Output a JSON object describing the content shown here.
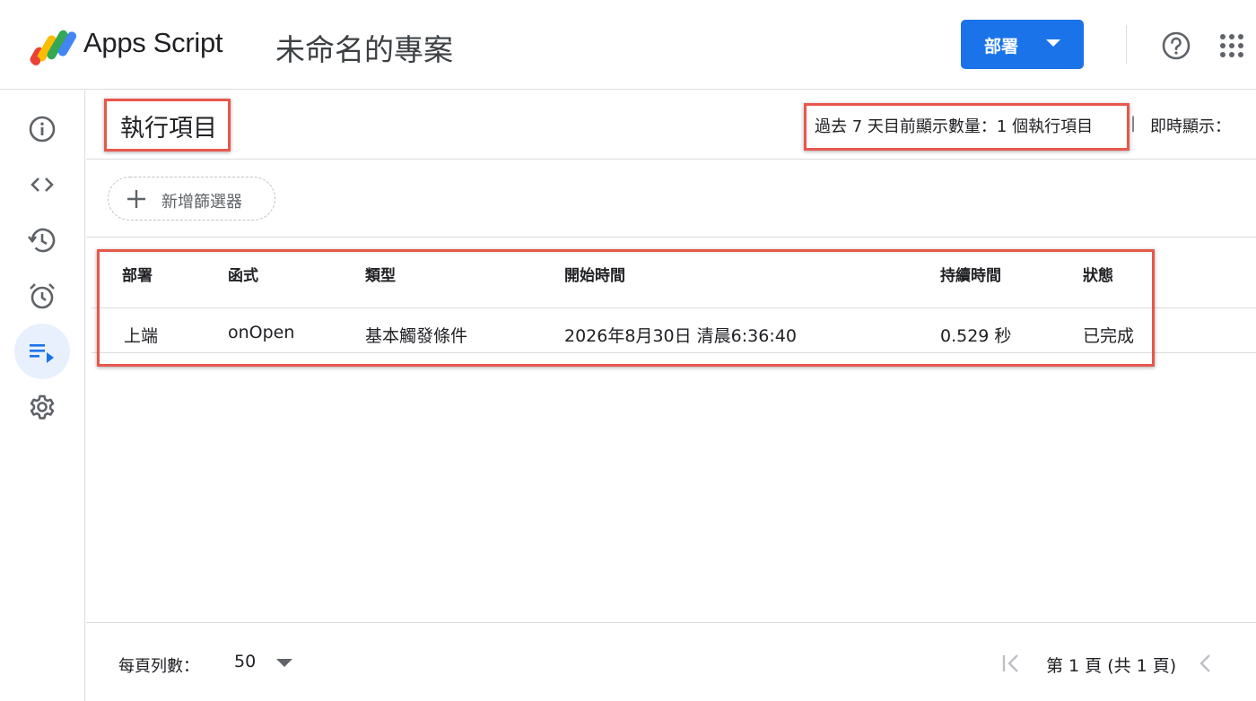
{
  "header": {
    "app_name": "Apps Script",
    "project_name": "未命名的專案",
    "deploy_label": "部署"
  },
  "sidebar": {
    "items": [
      {
        "icon": "info-icon",
        "active": false
      },
      {
        "icon": "code-icon",
        "active": false
      },
      {
        "icon": "history-icon",
        "active": false
      },
      {
        "icon": "alarm-icon",
        "active": false
      },
      {
        "icon": "executions-icon",
        "active": true
      },
      {
        "icon": "settings-icon",
        "active": false
      }
    ]
  },
  "executions": {
    "title": "執行項目",
    "summary": "過去 7 天目前顯示數量：1 個執行項目",
    "separator": "|",
    "live_label": "即時顯示：",
    "add_filter_label": "新增篩選器"
  },
  "table": {
    "headers": [
      "部署",
      "函式",
      "類型",
      "開始時間",
      "持續時間",
      "狀態"
    ],
    "rows": [
      [
        "上端",
        "onOpen",
        "基本觸發條件",
        "2026年8月30日 清晨6:36:40",
        "0.529 秒",
        "已完成"
      ]
    ]
  },
  "footer": {
    "rows_per_page_label": "每頁列數：",
    "rows_per_page_value": "50",
    "page_info": "第 1 頁 (共 1 頁)"
  },
  "colors": {
    "accent": "#1a73e8",
    "annotation": "#e8574b",
    "active_bg": "#e8f0fe"
  }
}
